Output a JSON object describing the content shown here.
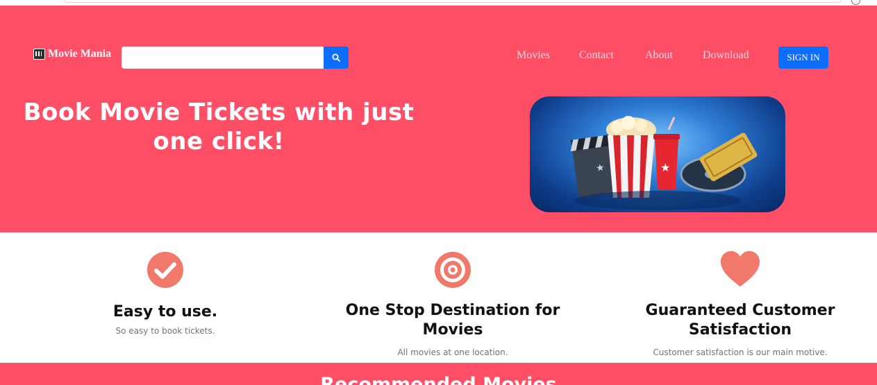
{
  "brand": {
    "name": "Movie Mania",
    "logo_icon": "clapperboard-icon"
  },
  "search": {
    "placeholder": "",
    "value": "",
    "button_icon": "search-icon"
  },
  "nav": {
    "items": [
      "Movies",
      "Contact",
      "About",
      "Download"
    ],
    "signin_label": "SIGN IN"
  },
  "hero": {
    "headline": "Book Movie Tickets with just one click!",
    "image": "popcorn-cinema-tickets-illustration"
  },
  "features": [
    {
      "icon": "check-circle-icon",
      "title": "Easy to use.",
      "text": "So easy to book tickets."
    },
    {
      "icon": "target-icon",
      "title": "One Stop Destination for Movies",
      "text": "All movies at one location."
    },
    {
      "icon": "heart-icon",
      "title": "Guaranteed Customer Satisfaction",
      "text": "Customer satisfaction is our main motive."
    }
  ],
  "recommended": {
    "title": "Recommended Movies"
  },
  "colors": {
    "brand": "#ff4f66",
    "button": "#0d6efd",
    "icon": "#f0796a",
    "heading": "#111111",
    "muted": "#6c757d"
  }
}
